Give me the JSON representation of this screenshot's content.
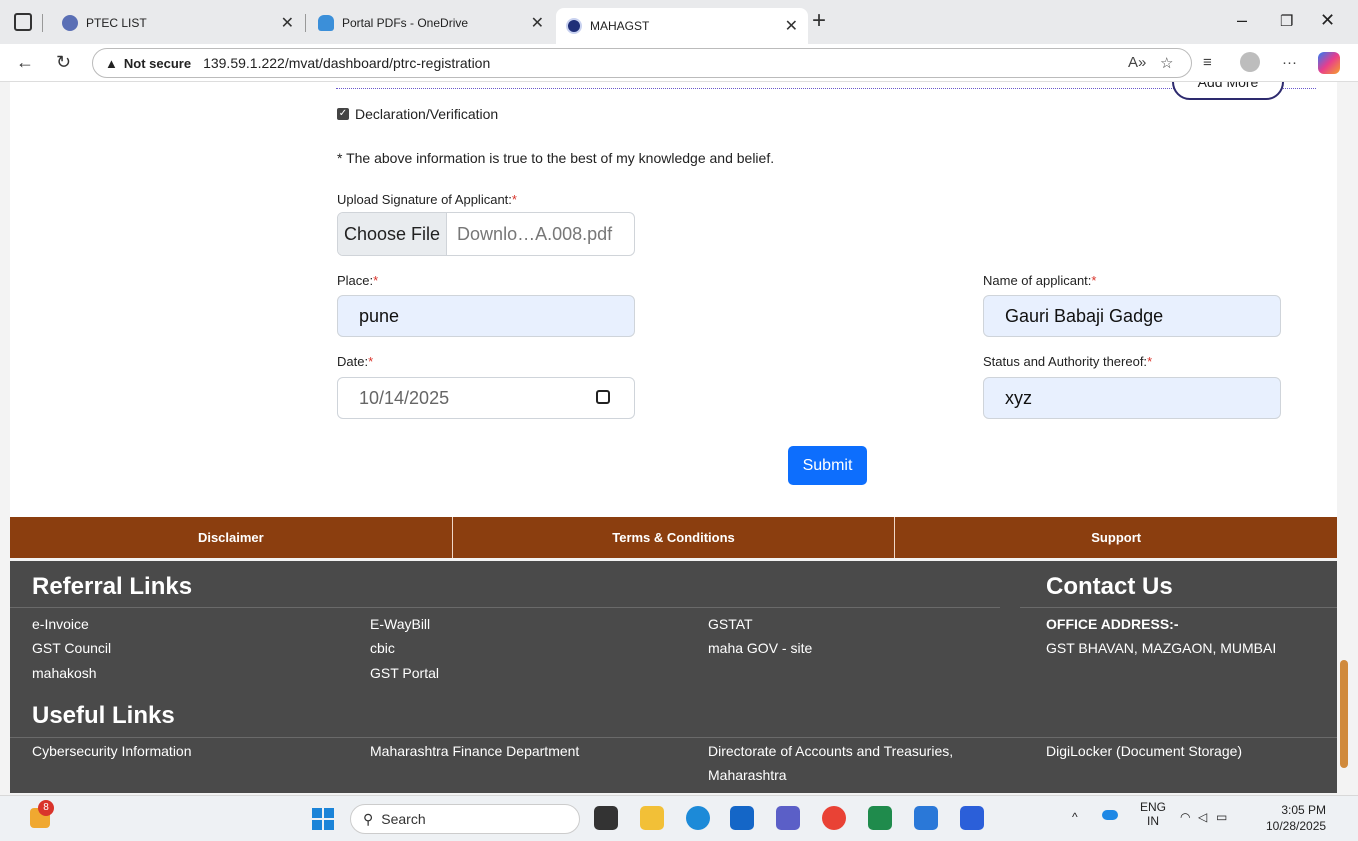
{
  "browser": {
    "tabs": [
      {
        "label": "PTEC LIST",
        "active": false
      },
      {
        "label": "Portal PDFs - OneDrive",
        "active": false
      },
      {
        "label": "MAHAGST",
        "active": true
      }
    ],
    "new_tab": "+",
    "window_controls": {
      "minimize": "–",
      "restore": "❐",
      "close": "✕"
    },
    "security_label": "Not secure",
    "url": "139.59.1.222/mvat/dashboard/ptrc-registration"
  },
  "form": {
    "add_more_label": "Add More",
    "declaration_label": "Declaration/Verification",
    "declaration_checked": true,
    "declaration_note": "* The above information is true to the best of my knowledge and belief.",
    "signature_label": "Upload Signature of Applicant:",
    "choose_file_label": "Choose File",
    "file_name": "Downlo…A.008.pdf",
    "place_label": "Place:",
    "place_value": "pune",
    "applicant_label": "Name of applicant:",
    "applicant_value": "Gauri Babaji Gadge",
    "date_label": "Date:",
    "date_value": "10/14/2025",
    "status_label": "Status and Authority thereof:",
    "status_value": "xyz",
    "required_mark": "*",
    "submit_label": "Submit"
  },
  "footer_nav": [
    "Disclaimer",
    "Terms & Conditions",
    "Support"
  ],
  "footer": {
    "referral_title": "Referral Links",
    "referral_links": [
      [
        "e-Invoice",
        "E-WayBill",
        "GSTAT"
      ],
      [
        "GST Council",
        "cbic",
        "maha GOV - site"
      ],
      [
        "mahakosh",
        "GST Portal"
      ]
    ],
    "contact_title": "Contact Us",
    "office_label": "OFFICE ADDRESS:-",
    "office_address": "GST BHAVAN, MAZGAON, MUMBAI",
    "useful_title": "Useful Links",
    "useful_links": [
      "Cybersecurity Information",
      "Maharashtra Finance Department",
      "Directorate of Accounts and Treasuries,",
      "DigiLocker (Document Storage)"
    ],
    "useful_links_cont": "Maharashtra"
  },
  "taskbar": {
    "notification_count": "8",
    "search_placeholder": "Search",
    "lang_line1": "ENG",
    "lang_line2": "IN",
    "time": "3:05 PM",
    "date": "10/28/2025"
  }
}
